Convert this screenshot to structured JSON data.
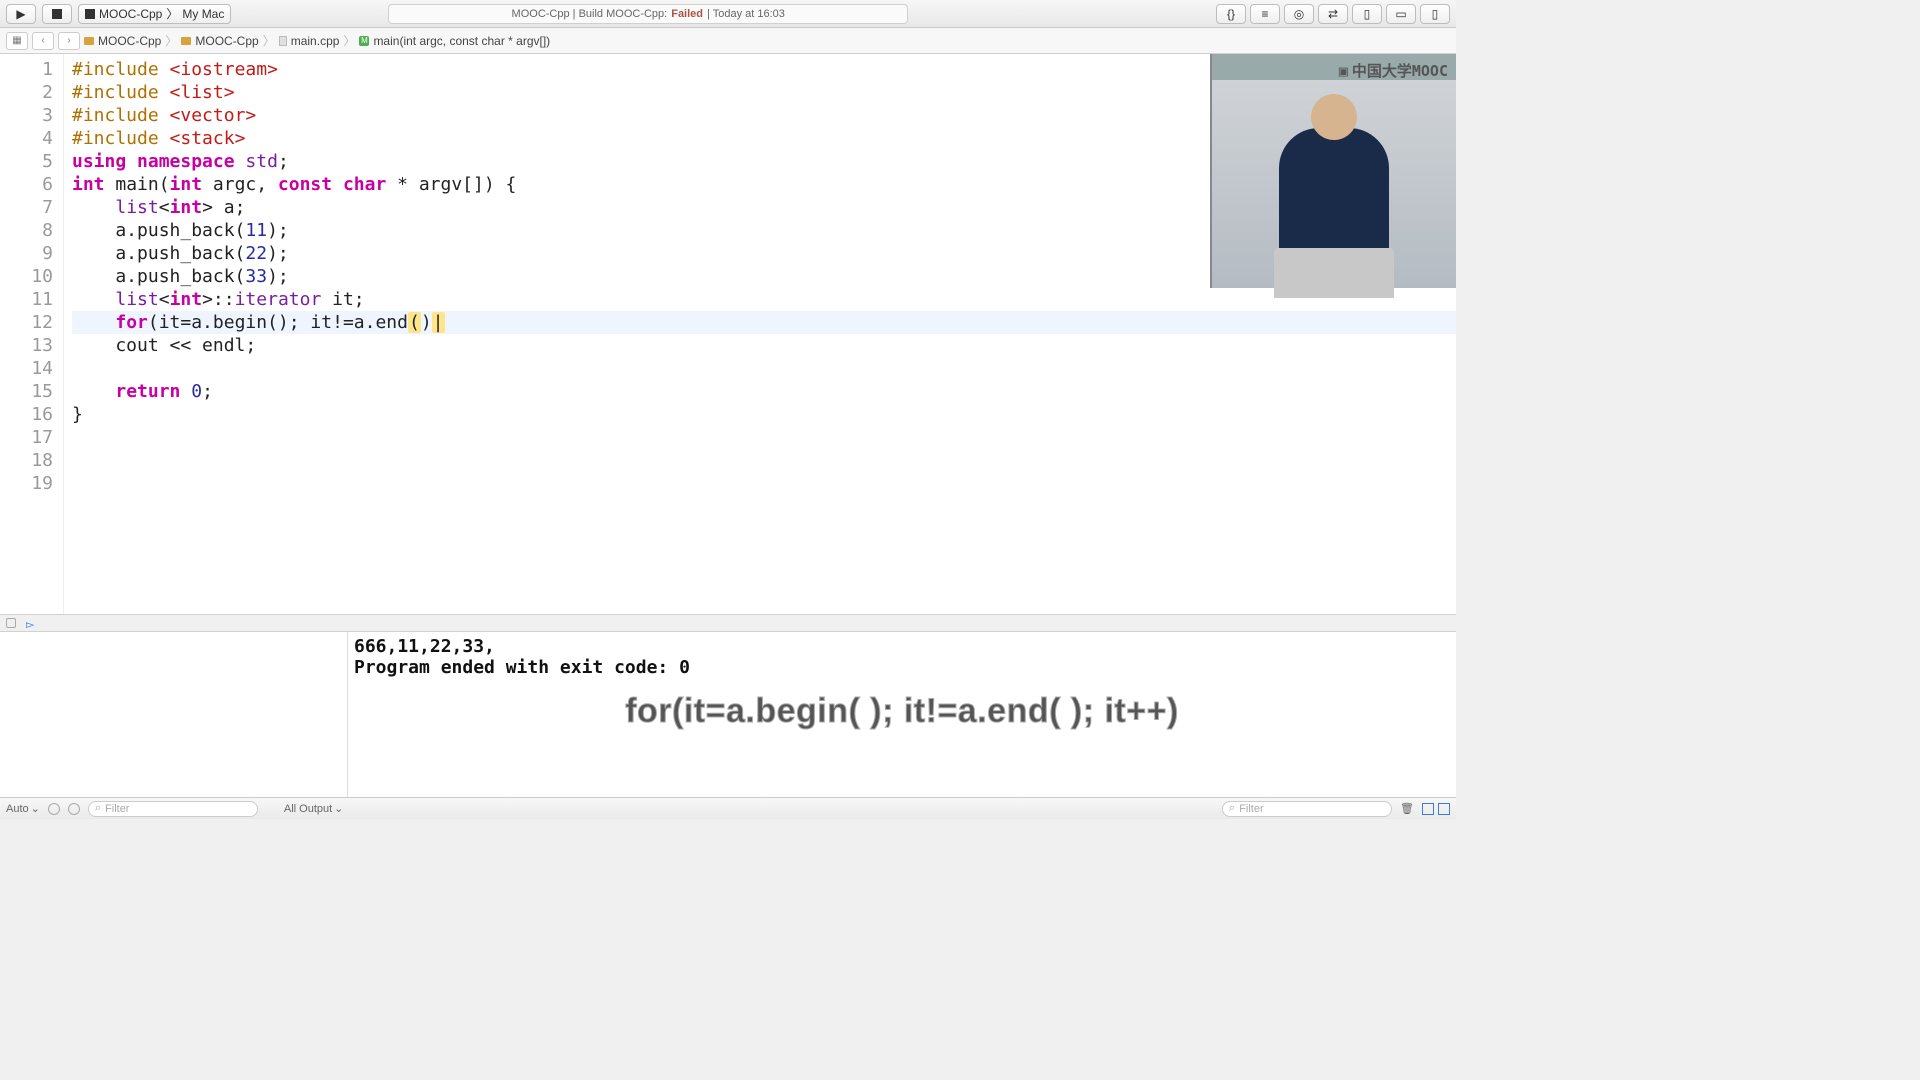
{
  "toolbar": {
    "scheme": "MOOC-Cpp",
    "target": "My Mac",
    "status_prefix": "MOOC-Cpp | Build MOOC-Cpp:",
    "status_result": "Failed",
    "status_time": "| Today at 16:03"
  },
  "pathbar": {
    "project": "MOOC-Cpp",
    "folder": "MOOC-Cpp",
    "file": "main.cpp",
    "symbol": "main(int argc, const char * argv[])"
  },
  "video_brand": "中国大学MOOC",
  "code_lines": [
    {
      "n": 1,
      "html": "<span class='pre'>#include</span> <span class='str'>&lt;iostream&gt;</span>"
    },
    {
      "n": 2,
      "html": "<span class='pre'>#include</span> <span class='str'>&lt;list&gt;</span>"
    },
    {
      "n": 3,
      "html": "<span class='pre'>#include</span> <span class='str'>&lt;vector&gt;</span>"
    },
    {
      "n": 4,
      "html": "<span class='pre'>#include</span> <span class='str'>&lt;stack&gt;</span>"
    },
    {
      "n": 5,
      "html": "<span class='kw'>using</span> <span class='kw'>namespace</span> <span class='type'>std</span>;"
    },
    {
      "n": 6,
      "html": "<span class='kw'>int</span> main(<span class='kw'>int</span> argc, <span class='kw'>const</span> <span class='kw'>char</span> * argv[]) {"
    },
    {
      "n": 7,
      "html": "    <span class='type'>list</span>&lt;<span class='kw'>int</span>&gt; a;"
    },
    {
      "n": 8,
      "html": "    a.push_back(<span class='num'>11</span>);"
    },
    {
      "n": 9,
      "html": "    a.push_back(<span class='num'>22</span>);"
    },
    {
      "n": 10,
      "html": "    a.push_back(<span class='num'>33</span>);"
    },
    {
      "n": 11,
      "html": "    <span class='type'>list</span>&lt;<span class='kw'>int</span>&gt;::<span class='type'>iterator</span> it;"
    },
    {
      "n": 12,
      "cur": true,
      "html": "    <span class='kw'>for</span>(it=a.begin(); it!=a.end<span class='hlp'>(</span>)<span class='hlp'>|</span>"
    },
    {
      "n": 13,
      "html": "    cout &lt;&lt; endl;"
    },
    {
      "n": 14,
      "html": ""
    },
    {
      "n": 15,
      "html": "    <span class='kw'>return</span> <span class='num'>0</span>;"
    },
    {
      "n": 16,
      "html": "}"
    },
    {
      "n": 17,
      "html": ""
    },
    {
      "n": 18,
      "html": ""
    },
    {
      "n": 19,
      "html": ""
    }
  ],
  "console": {
    "line1": "666,11,22,33,",
    "line2": "Program ended with exit code: 0",
    "subtitle": "for(it=a.begin( ); it!=a.end( ); it++)"
  },
  "bottombar": {
    "auto_label": "Auto",
    "filter_placeholder": "Filter",
    "all_output": "All Output"
  }
}
